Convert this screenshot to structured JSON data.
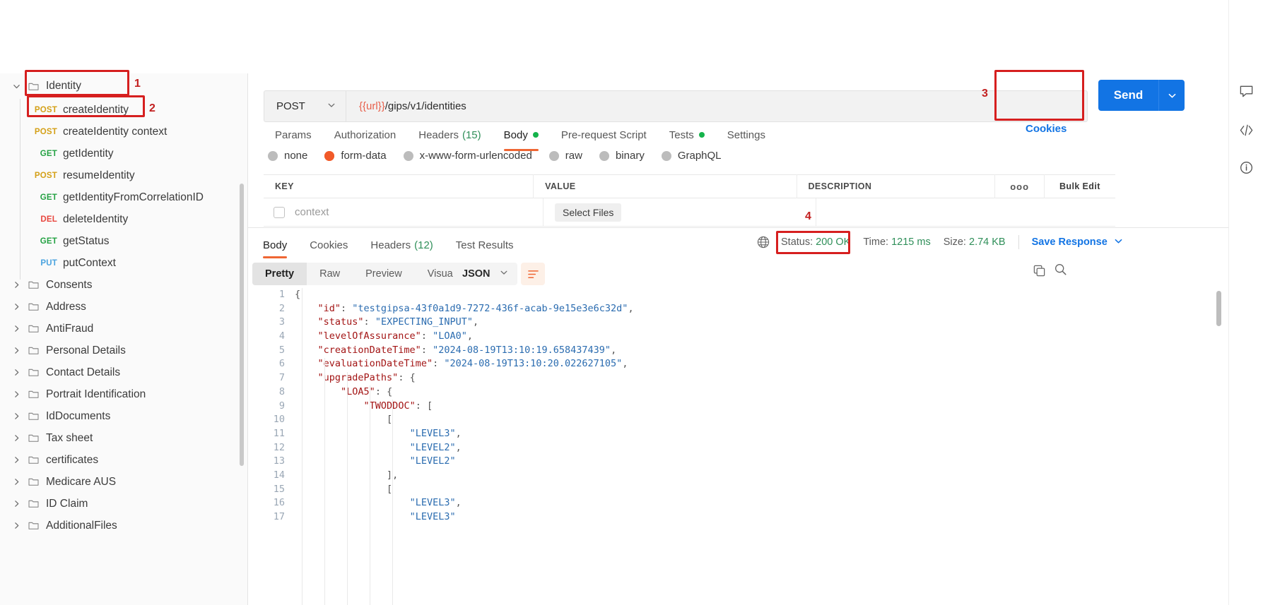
{
  "sidebar": {
    "folder_selected": {
      "label": "Identity",
      "expanded": true
    },
    "requests": [
      {
        "method": "POST",
        "name": "createIdentity",
        "selected": true
      },
      {
        "method": "POST",
        "name": "createIdentity context",
        "selected": false
      },
      {
        "method": "GET",
        "name": "getIdentity",
        "selected": false
      },
      {
        "method": "POST",
        "name": "resumeIdentity",
        "selected": false
      },
      {
        "method": "GET",
        "name": "getIdentityFromCorrelationID",
        "selected": false
      },
      {
        "method": "DEL",
        "name": "deleteIdentity",
        "selected": false
      },
      {
        "method": "GET",
        "name": "getStatus",
        "selected": false
      },
      {
        "method": "PUT",
        "name": "putContext",
        "selected": false
      }
    ],
    "folders": [
      {
        "label": "Consents"
      },
      {
        "label": "Address"
      },
      {
        "label": "AntiFraud"
      },
      {
        "label": "Personal Details"
      },
      {
        "label": "Contact Details"
      },
      {
        "label": "Portrait Identification"
      },
      {
        "label": "IdDocuments"
      },
      {
        "label": "Tax sheet"
      },
      {
        "label": "certificates"
      },
      {
        "label": "Medicare AUS"
      },
      {
        "label": "ID Claim"
      },
      {
        "label": "AdditionalFiles"
      }
    ]
  },
  "annotations": {
    "one": "1",
    "two": "2",
    "three": "3",
    "four": "4"
  },
  "request": {
    "method": "POST",
    "url_variable": "{{url}}",
    "url_path": "/gips/v1/identities",
    "send_label": "Send",
    "cookies_label": "Cookies",
    "tabs": [
      {
        "label": "Params",
        "active": false,
        "dot": false,
        "count": ""
      },
      {
        "label": "Authorization",
        "active": false,
        "dot": false,
        "count": ""
      },
      {
        "label": "Headers",
        "active": false,
        "dot": false,
        "count": "(15)"
      },
      {
        "label": "Body",
        "active": true,
        "dot": true,
        "count": ""
      },
      {
        "label": "Pre-request Script",
        "active": false,
        "dot": false,
        "count": ""
      },
      {
        "label": "Tests",
        "active": false,
        "dot": true,
        "count": ""
      },
      {
        "label": "Settings",
        "active": false,
        "dot": false,
        "count": ""
      }
    ],
    "body_types": [
      {
        "label": "none",
        "selected": false
      },
      {
        "label": "form-data",
        "selected": true
      },
      {
        "label": "x-www-form-urlencoded",
        "selected": false
      },
      {
        "label": "raw",
        "selected": false
      },
      {
        "label": "binary",
        "selected": false
      },
      {
        "label": "GraphQL",
        "selected": false
      }
    ],
    "table": {
      "headers": {
        "key": "KEY",
        "value": "VALUE",
        "description": "DESCRIPTION",
        "more": "ooo",
        "bulk_edit": "Bulk Edit"
      },
      "rows": [
        {
          "key": "context",
          "value_button": "Select Files",
          "description": "",
          "checked": false
        }
      ]
    }
  },
  "response": {
    "tabs": [
      {
        "label": "Body",
        "active": true,
        "count": ""
      },
      {
        "label": "Cookies",
        "active": false,
        "count": ""
      },
      {
        "label": "Headers",
        "active": false,
        "count": "(12)"
      },
      {
        "label": "Test Results",
        "active": false,
        "count": ""
      }
    ],
    "status_label": "Status:",
    "status_value": "200 OK",
    "time_label": "Time:",
    "time_value": "1215 ms",
    "size_label": "Size:",
    "size_value": "2.74 KB",
    "save_response": "Save Response",
    "view_modes": [
      {
        "label": "Pretty",
        "active": true
      },
      {
        "label": "Raw",
        "active": false
      },
      {
        "label": "Preview",
        "active": false
      },
      {
        "label": "Visualize",
        "active": false
      }
    ],
    "format": "JSON",
    "code_lines": [
      {
        "n": "1",
        "segments": [
          {
            "t": "{",
            "c": "pun"
          }
        ]
      },
      {
        "n": "2",
        "segments": [
          {
            "t": "    ",
            "c": "pun"
          },
          {
            "t": "\"id\"",
            "c": "key"
          },
          {
            "t": ": ",
            "c": "pun"
          },
          {
            "t": "\"testgipsa-43f0a1d9-7272-436f-acab-9e15e3e6c32d\"",
            "c": "str"
          },
          {
            "t": ",",
            "c": "pun"
          }
        ]
      },
      {
        "n": "3",
        "segments": [
          {
            "t": "    ",
            "c": "pun"
          },
          {
            "t": "\"status\"",
            "c": "key"
          },
          {
            "t": ": ",
            "c": "pun"
          },
          {
            "t": "\"EXPECTING_INPUT\"",
            "c": "str"
          },
          {
            "t": ",",
            "c": "pun"
          }
        ]
      },
      {
        "n": "4",
        "segments": [
          {
            "t": "    ",
            "c": "pun"
          },
          {
            "t": "\"levelOfAssurance\"",
            "c": "key"
          },
          {
            "t": ": ",
            "c": "pun"
          },
          {
            "t": "\"LOA0\"",
            "c": "str"
          },
          {
            "t": ",",
            "c": "pun"
          }
        ]
      },
      {
        "n": "5",
        "segments": [
          {
            "t": "    ",
            "c": "pun"
          },
          {
            "t": "\"creationDateTime\"",
            "c": "key"
          },
          {
            "t": ": ",
            "c": "pun"
          },
          {
            "t": "\"2024-08-19T13:10:19.658437439\"",
            "c": "str"
          },
          {
            "t": ",",
            "c": "pun"
          }
        ]
      },
      {
        "n": "6",
        "segments": [
          {
            "t": "    ",
            "c": "pun"
          },
          {
            "t": "\"evaluationDateTime\"",
            "c": "key"
          },
          {
            "t": ": ",
            "c": "pun"
          },
          {
            "t": "\"2024-08-19T13:10:20.022627105\"",
            "c": "str"
          },
          {
            "t": ",",
            "c": "pun"
          }
        ]
      },
      {
        "n": "7",
        "segments": [
          {
            "t": "    ",
            "c": "pun"
          },
          {
            "t": "\"upgradePaths\"",
            "c": "key"
          },
          {
            "t": ": {",
            "c": "pun"
          }
        ]
      },
      {
        "n": "8",
        "segments": [
          {
            "t": "        ",
            "c": "pun"
          },
          {
            "t": "\"LOA5\"",
            "c": "key"
          },
          {
            "t": ": {",
            "c": "pun"
          }
        ]
      },
      {
        "n": "9",
        "segments": [
          {
            "t": "            ",
            "c": "pun"
          },
          {
            "t": "\"TWODDOC\"",
            "c": "key"
          },
          {
            "t": ": [",
            "c": "pun"
          }
        ]
      },
      {
        "n": "10",
        "segments": [
          {
            "t": "                [",
            "c": "pun"
          }
        ]
      },
      {
        "n": "11",
        "segments": [
          {
            "t": "                    ",
            "c": "pun"
          },
          {
            "t": "\"LEVEL3\"",
            "c": "str"
          },
          {
            "t": ",",
            "c": "pun"
          }
        ]
      },
      {
        "n": "12",
        "segments": [
          {
            "t": "                    ",
            "c": "pun"
          },
          {
            "t": "\"LEVEL2\"",
            "c": "str"
          },
          {
            "t": ",",
            "c": "pun"
          }
        ]
      },
      {
        "n": "13",
        "segments": [
          {
            "t": "                    ",
            "c": "pun"
          },
          {
            "t": "\"LEVEL2\"",
            "c": "str"
          }
        ]
      },
      {
        "n": "14",
        "segments": [
          {
            "t": "                ],",
            "c": "pun"
          }
        ]
      },
      {
        "n": "15",
        "segments": [
          {
            "t": "                [",
            "c": "pun"
          }
        ]
      },
      {
        "n": "16",
        "segments": [
          {
            "t": "                    ",
            "c": "pun"
          },
          {
            "t": "\"LEVEL3\"",
            "c": "str"
          },
          {
            "t": ",",
            "c": "pun"
          }
        ]
      },
      {
        "n": "17",
        "segments": [
          {
            "t": "                    ",
            "c": "pun"
          },
          {
            "t": "\"LEVEL3\"",
            "c": "str"
          }
        ]
      }
    ]
  },
  "colors": {
    "accent_orange": "#ef6633",
    "send_blue": "#1274e4",
    "status_green": "#2f8f59",
    "annotation_red": "#d61f1f",
    "method_post": "#d4a017",
    "method_get": "#25a244",
    "method_del": "#e8473f",
    "method_put": "#4aa3df"
  }
}
